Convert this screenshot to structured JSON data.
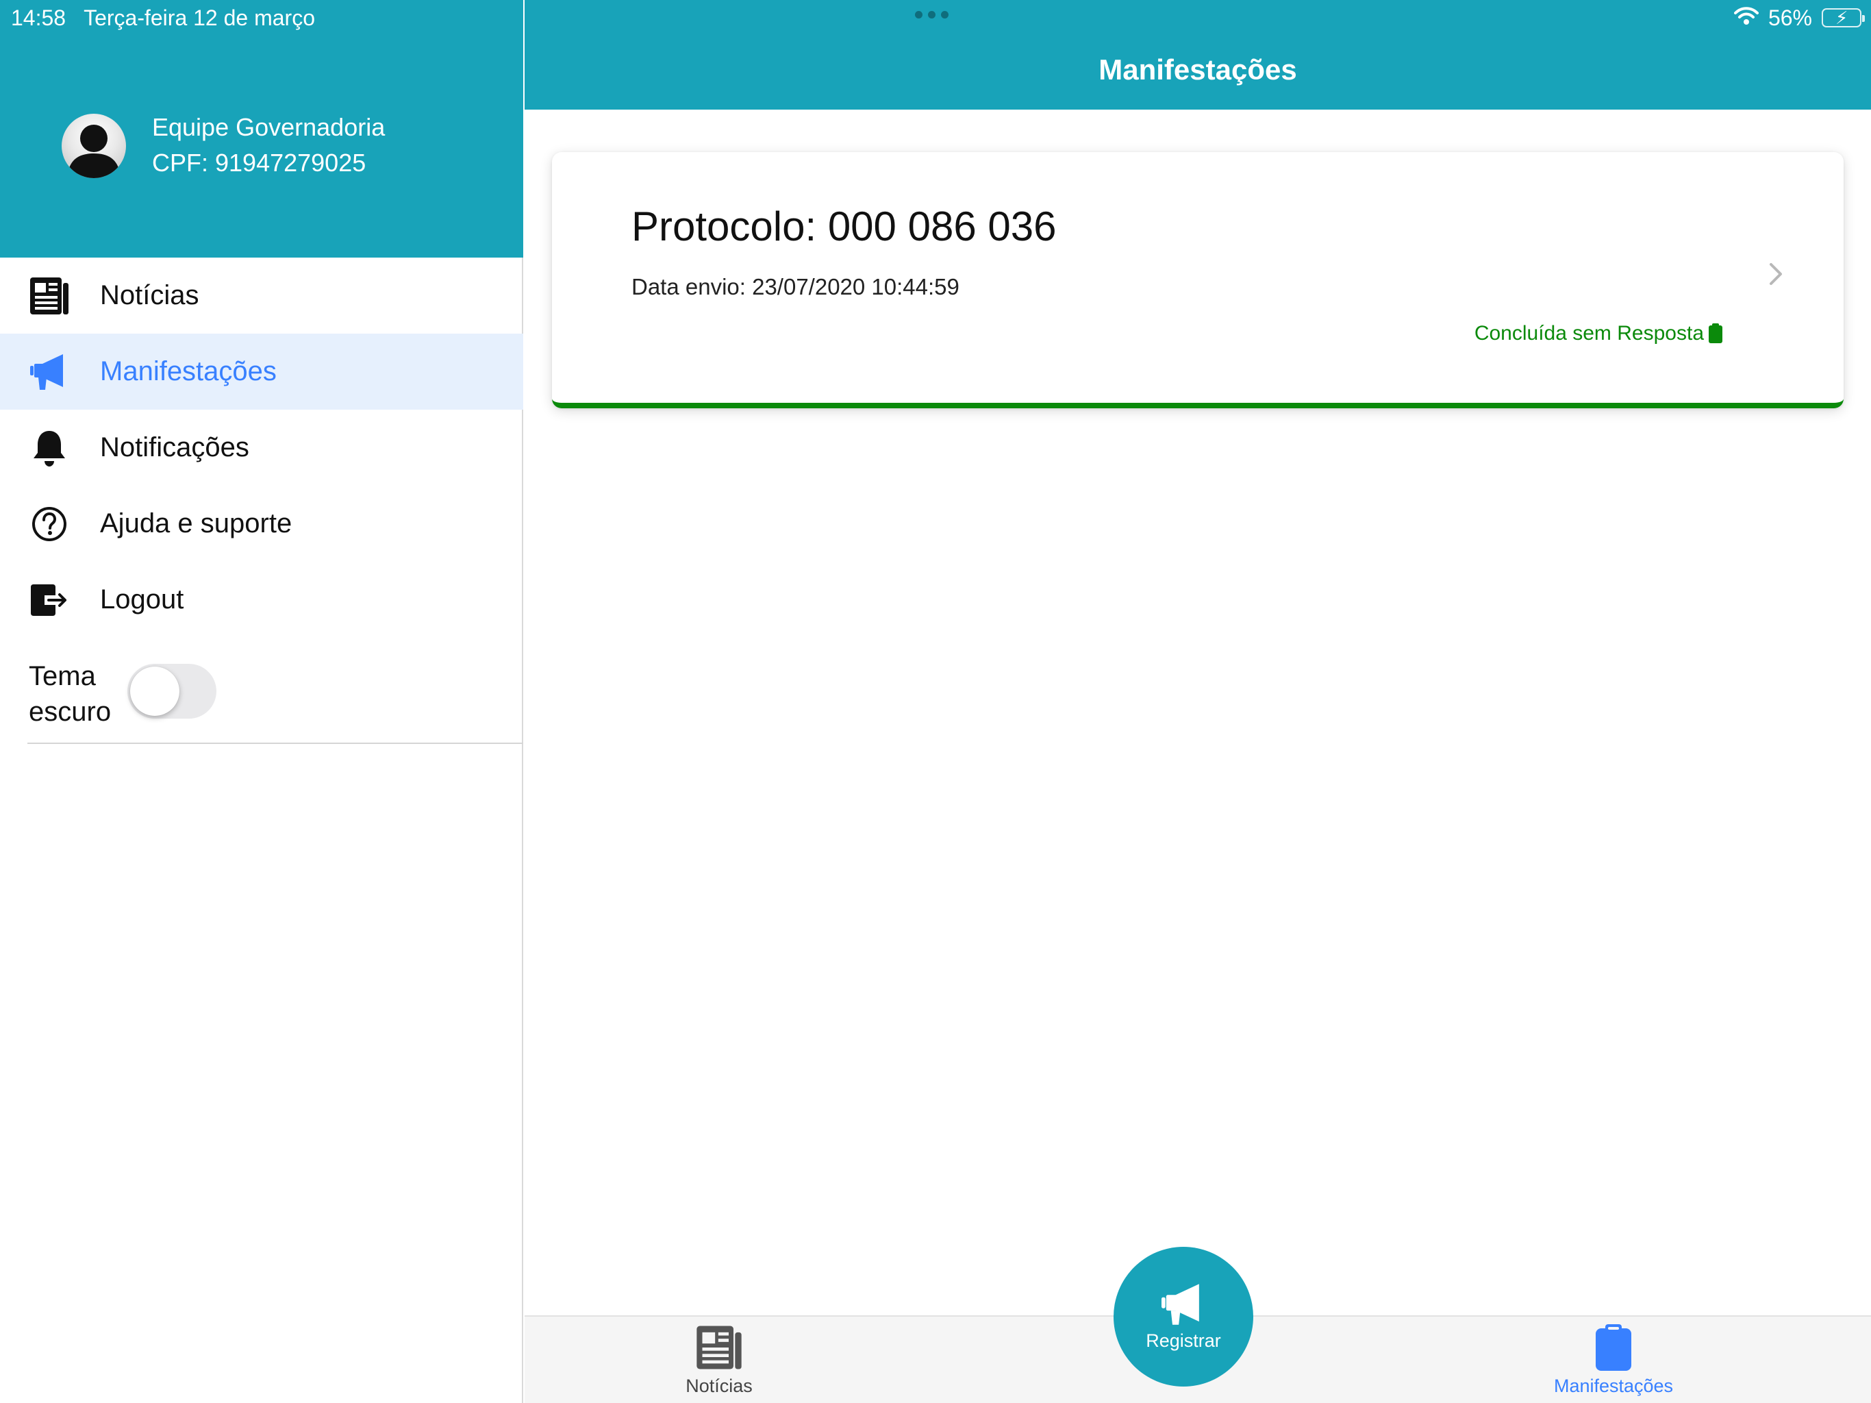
{
  "status_bar": {
    "time": "14:58",
    "date": "Terça-feira 12 de março",
    "battery": "56%",
    "battery_level": 0.56
  },
  "profile": {
    "name": "Equipe Governadoria",
    "cpf": "CPF: 91947279025"
  },
  "menu": {
    "items": [
      {
        "label": "Notícias",
        "icon": "newspaper-icon"
      },
      {
        "label": "Manifestações",
        "icon": "megaphone-icon",
        "active": true
      },
      {
        "label": "Notificações",
        "icon": "bell-icon"
      },
      {
        "label": "Ajuda e suporte",
        "icon": "help-circle-icon"
      },
      {
        "label": "Logout",
        "icon": "logout-icon"
      }
    ],
    "theme_label": "Tema escuro",
    "theme_on": false
  },
  "header": {
    "title": "Manifestações"
  },
  "card": {
    "protocol": "Protocolo: 000 086 036",
    "date": "Data envio: 23/07/2020 10:44:59",
    "status": "Concluída sem Resposta"
  },
  "tabbar": {
    "news_label": "Notícias",
    "register_label": "Registrar",
    "manifest_label": "Manifestações"
  },
  "colors": {
    "primary": "#18a3b9",
    "active": "#3880ff",
    "status_green": "#0b8a0b"
  }
}
